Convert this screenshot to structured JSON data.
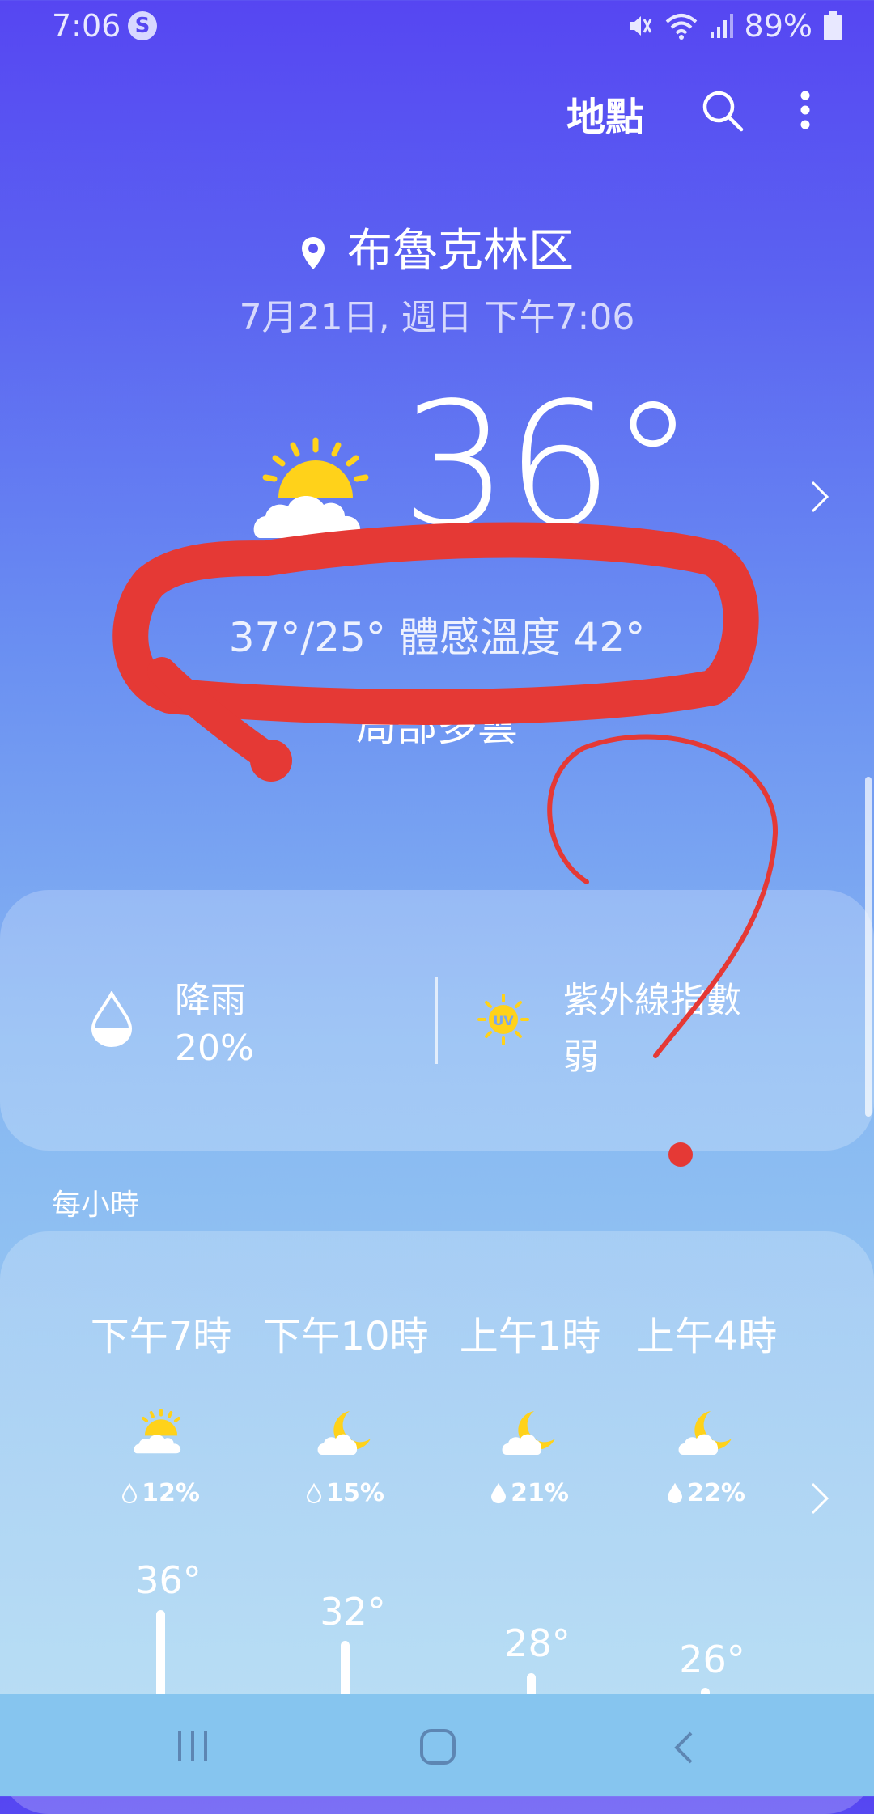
{
  "status_bar": {
    "time": "7:06",
    "battery": "89%",
    "app_badge": "S"
  },
  "header": {
    "location_button": "地點",
    "icons": [
      "search-icon",
      "more-vert-icon"
    ]
  },
  "location": {
    "name": "布魯克林区",
    "datetime": "7月21日, 週日 下午7:06"
  },
  "current": {
    "temperature": "36°",
    "high_low_feels": "37°/25° 體感溫度 42°",
    "condition": "局部多雲",
    "icon": "partly-cloudy-icon"
  },
  "details": {
    "rain_label": "降雨",
    "rain_value": "20%",
    "uv_label": "紫外線指數",
    "uv_value": "弱",
    "uv_badge": "UV"
  },
  "hourly": {
    "title": "每小時",
    "items": [
      {
        "time": "下午7時",
        "precip": "12%",
        "temp": "36°",
        "icon": "partly-cloudy-icon"
      },
      {
        "time": "下午10時",
        "precip": "15%",
        "temp": "32°",
        "icon": "moon-cloud-icon"
      },
      {
        "time": "上午1時",
        "precip": "21%",
        "temp": "28°",
        "icon": "moon-cloud-icon"
      },
      {
        "time": "上午4時",
        "precip": "22%",
        "temp": "26°",
        "icon": "moon-cloud-icon"
      }
    ]
  },
  "colors": {
    "sun": "#ffd21a",
    "annotation_red": "#e53935",
    "bg_top": "#5646f2",
    "bg_bottom": "#a4d4f1"
  },
  "nav": {
    "icons": [
      "recent-apps-icon",
      "home-icon",
      "back-icon"
    ]
  }
}
